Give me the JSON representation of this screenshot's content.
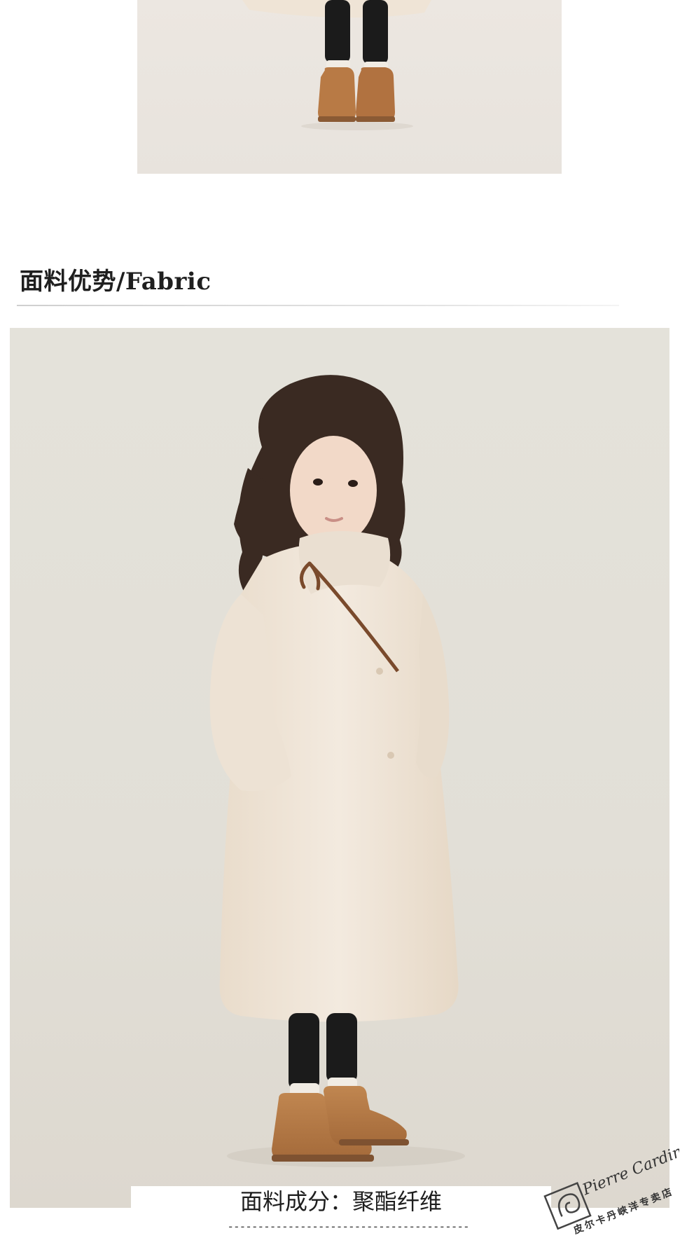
{
  "section": {
    "title": "面料优势/Fabric"
  },
  "caption": {
    "fabric_composition": "面料成分：聚酯纤维",
    "separator": "----------------------------------------"
  },
  "watermark": {
    "logo_script": "Pierre Cardin",
    "store_name": "皮尔卡丹峡洋专卖店"
  },
  "colors": {
    "coat": "#efe4d6",
    "boots": "#b87a45",
    "leggings": "#1b1b1b",
    "backdrop": "#e3e0d8"
  }
}
